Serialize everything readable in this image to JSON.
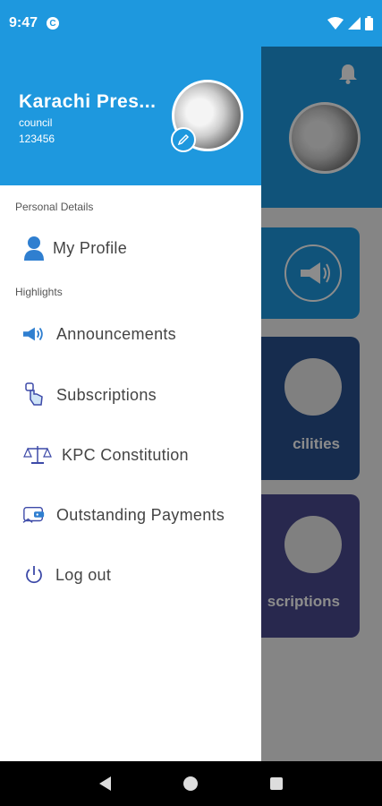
{
  "status_bar": {
    "time": "9:47",
    "app_icon_letter": "C"
  },
  "background": {
    "cards": [
      {
        "label": ""
      },
      {
        "label": "cilities"
      },
      {
        "label": "scriptions"
      }
    ]
  },
  "drawer": {
    "user": {
      "name": "Karachi Pres...",
      "role": "council",
      "id": "123456"
    },
    "sections": {
      "personal": "Personal Details",
      "highlights": "Highlights"
    },
    "items": {
      "profile": "My Profile",
      "announcements": "Announcements",
      "subscriptions": "Subscriptions",
      "constitution": "KPC Constitution",
      "payments": "Outstanding Payments",
      "logout": "Log out"
    }
  },
  "colors": {
    "brand_blue": "#1e98de",
    "icon_blue": "#2f7fd0",
    "icon_indigo": "#3d4aa8"
  }
}
